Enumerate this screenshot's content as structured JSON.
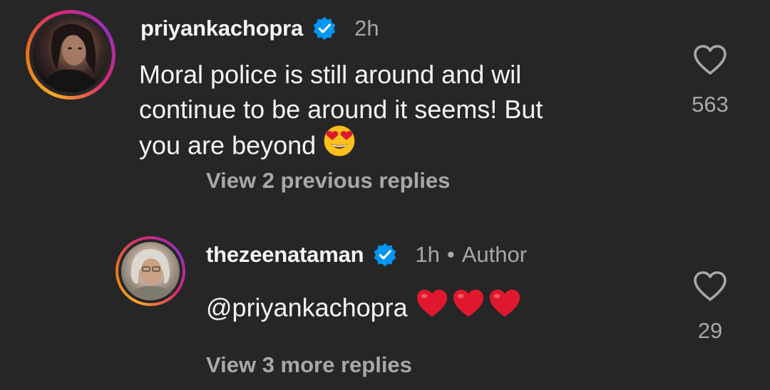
{
  "comments": [
    {
      "username": "priyankachopra",
      "verified": true,
      "time": "2h",
      "text_lines": [
        "Moral police is still around and wil",
        "continue to be around it seems! But",
        "you are beyond"
      ],
      "emoji": "heart-eyes",
      "view_replies": "View 2 previous replies",
      "likes": "563"
    },
    {
      "username": "thezeenataman",
      "verified": true,
      "time": "1h",
      "separator": "•",
      "badge": "Author",
      "mention": "@priyankachopra",
      "emoji": "red-hearts",
      "view_replies": "View 3 more replies",
      "likes": "29"
    }
  ],
  "colors": {
    "background": "#262626",
    "primary_text": "#f5f5f5",
    "secondary_text": "#a8a8a8",
    "verified_blue": "#0095f6",
    "heart_red": "#e0182d",
    "emoji_yellow": "#fcc21b"
  }
}
